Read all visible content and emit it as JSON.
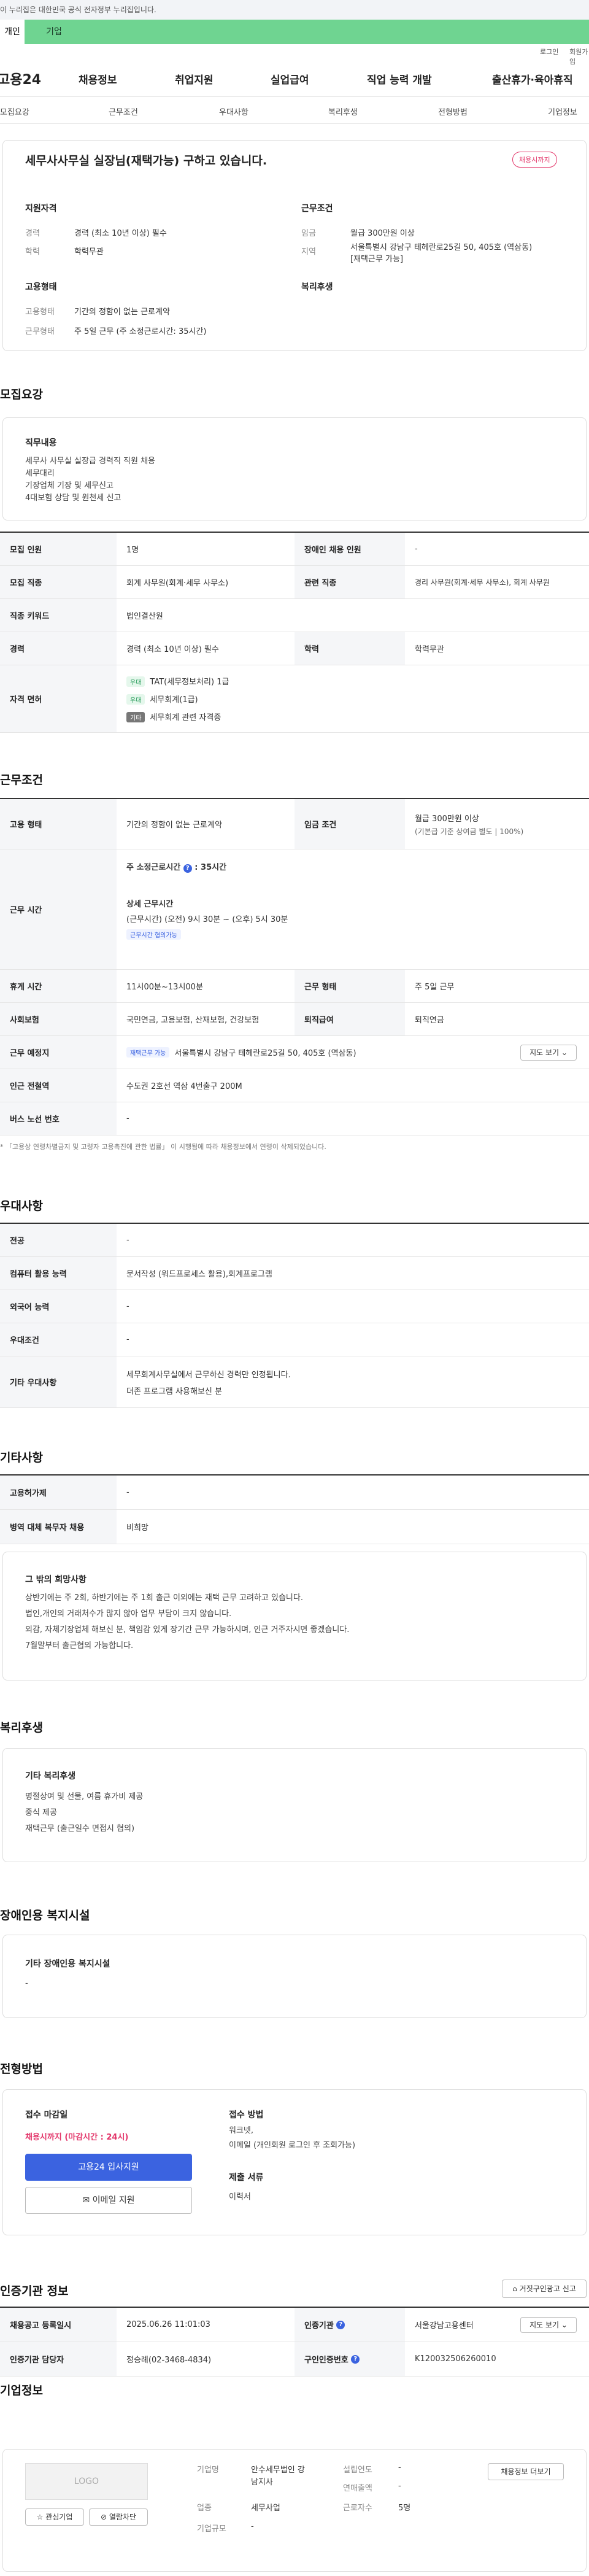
{
  "gov_banner": "이 누리집은 대한민국 공식 전자정부 누리집입니다.",
  "top_tabs": [
    "개인",
    "기업"
  ],
  "util": {
    "login": "로그인",
    "join": "회원가입"
  },
  "logo": "고용24",
  "gnb": [
    "채용정보",
    "취업지원",
    "실업급여",
    "직업 능력 개발",
    "출산휴가·육아휴직"
  ],
  "anchors": [
    "모집요강",
    "근무조건",
    "우대사항",
    "복리후생",
    "전형방법",
    "기업정보"
  ],
  "summary": {
    "title": "세무사사무실 실장님(재택가능) 구하고 있습니다.",
    "badge": "채용시까지",
    "qual_title": "지원자격",
    "career_label": "경력",
    "career": "경력 (최소 10년 이상) 필수",
    "edu_label": "학력",
    "edu": "학력무관",
    "cond_title": "근무조건",
    "wage_label": "임금",
    "wage": "월급 300만원 이상",
    "area_label": "지역",
    "area": "서울특별시 강남구 테헤란로25길 50, 405호 (역삼동)",
    "area2": "[재택근무 가능]",
    "emp_title": "고용형태",
    "emp_type_label": "고용형태",
    "emp_type": "기간의 정함이 없는 근로계약",
    "work_type_label": "근무형태",
    "work_type": "주 5일 근무 (주 소정근로시간: 35시간)",
    "welfare_title": "복리후생"
  },
  "recruit": {
    "heading": "모집요강",
    "duty_title": "직무내용",
    "duties": [
      "세무사 사무실 실장급 경력직 직원 채용",
      "세무대리",
      "기장업체 기장 및 세무신고",
      "4대보험 상담 및 원천세 신고"
    ],
    "rows": {
      "count_label": "모집 인원",
      "count": "1명",
      "dis_label": "장애인 채용 인원",
      "dis": "-",
      "job_label": "모집 직종",
      "job": "회계 사무원(회계·세무 사무소)",
      "rel_label": "관련 직종",
      "rel": "경리 사무원(회계·세무 사무소), 회계 사무원",
      "kw_label": "직종 키워드",
      "kw": "법인결산원",
      "career_label": "경력",
      "career": "경력 (최소 10년 이상) 필수",
      "edu_label": "학력",
      "edu": "학력무관",
      "lic_label": "자격 면허",
      "licenses": [
        {
          "tag": "우대",
          "name": "TAT(세무정보처리) 1급"
        },
        {
          "tag": "우대",
          "name": "세무회계(1급)"
        },
        {
          "tag": "기타",
          "name": "세무회계 관련 자격증"
        }
      ]
    }
  },
  "conditions": {
    "heading": "근무조건",
    "emp_label": "고용 형태",
    "emp": "기간의 정함이 없는 근로계약",
    "wage_label": "임금 조건",
    "wage": "월급 300만원 이상",
    "wage2": "(기본급 기준 상여금 별도 | 100%)",
    "time_label": "근무 시간",
    "weekly": "주 소정근로시간",
    "weekly_val": "35시간",
    "detail_title": "상세 근무시간",
    "detail": "(근무시간) (오전) 9시 30분 ~ (오후) 5시 30분",
    "detail_chip": "근무시간 협의가능",
    "rest_label": "휴게 시간",
    "rest": "11시00분~13시00분",
    "form_label": "근무 형태",
    "form": "주 5일 근무",
    "ins_label": "사회보험",
    "ins": "국민연금, 고용보험, 산재보험, 건강보험",
    "ret_label": "퇴직급여",
    "ret": "퇴직연금",
    "place_label": "근무 예정지",
    "place_chip": "재택근무 가능",
    "place": "서울특별시 강남구 테헤란로25길 50, 405호 (역삼동)",
    "map_btn": "지도 보기",
    "sub_label": "인근 전철역",
    "sub": "수도권 2호선 역삼 4번출구 200M",
    "bus_label": "버스 노선 번호",
    "bus": "-",
    "note": "* 「고용상 연령차별금지 및 고령자 고용촉진에 관한 법률」 이 시행됨에 따라 채용정보에서 연령이 삭제되었습니다."
  },
  "pref": {
    "heading": "우대사항",
    "major_label": "전공",
    "major": "-",
    "pc_label": "컴퓨터 활용 능력",
    "pc": "문서작성 (워드프로세스 활용),회계프로그램",
    "lang_label": "외국어 능력",
    "lang": "-",
    "cond_label": "우대조건",
    "cond": "-",
    "etc_label": "기타 우대사항",
    "etc1": "세무회계사무실에서 근무하신 경력만 인정됩니다.",
    "etc2": "더존 프로그램 사용해보신 분"
  },
  "etc": {
    "heading": "기타사항",
    "aux_label": "고용허가제",
    "aux": "-",
    "mil_label": "병역 대체 복무자 채용",
    "mil": "비희망",
    "other_title": "그 밖의 희망사항",
    "other": [
      "상반기에는 주 2회, 하반기에는 주 1회 출근 이외에는 재택 근무 고려하고 있습니다.",
      "법인,개인의 거래처수가 많지 않아 업무 부담이 크지 않습니다.",
      "외감, 자체기장업체 해보신 분, 책임감 있게 장기간 근무 가능하시며, 인근 거주자시면 좋겠습니다.",
      "7월말부터 출근협의 가능합니다."
    ]
  },
  "welfare": {
    "heading": "복리후생",
    "title": "기타 복리후생",
    "items": [
      "명절상여 및 선물, 여름 휴가비 제공",
      "중식 제공",
      "재택근무 (출근일수 면접시 협의)"
    ]
  },
  "disab": {
    "heading": "장애인용 복지시설",
    "title": "기타 장애인용 복지시설",
    "value": "-"
  },
  "process": {
    "heading": "전형방법",
    "deadline_title": "접수 마감일",
    "deadline": "채용시까지 (마감시간 : 24시)",
    "apply_btn": "고용24 입사지원",
    "email_btn": "이메일 지원",
    "method_title": "접수 방법",
    "methods": [
      "워크넷,",
      "이메일 (개인회원 로그인 후 조회가능)"
    ],
    "docs_title": "제출 서류",
    "docs": "이력서"
  },
  "cert": {
    "heading": "인증기관 정보",
    "report_btn": "거짓구인광고 신고",
    "reg_label": "채용공고 등록일시",
    "reg": "2025.06.26 11:01:03",
    "org_label": "인증기관",
    "org": "서울강남고용센터",
    "map_btn": "지도 보기",
    "mgr_label": "인증기관 담당자",
    "mgr": "정승례(02-3468-4834)",
    "no_label": "구인인증번호",
    "no": "K120032506260010"
  },
  "company": {
    "heading": "기업정보",
    "logo": "LOGO",
    "fav_btn": "관심기업",
    "follow_btn": "열람차단",
    "name_label": "기업명",
    "name1": "안수세무법인 강",
    "name2": "남지사",
    "biz_label": "업종",
    "biz": "세무사업",
    "size_label": "기업규모",
    "size": "-",
    "year_label": "설립연도",
    "year": "-",
    "sales_label": "연매출액",
    "sales": "-",
    "staff_label": "근로자수",
    "staff": "5명",
    "more_btn": "채용정보 더보기"
  },
  "colors": {
    "green": "#6fd491",
    "accent": "#e3366a",
    "blue": "#3b63e0"
  }
}
